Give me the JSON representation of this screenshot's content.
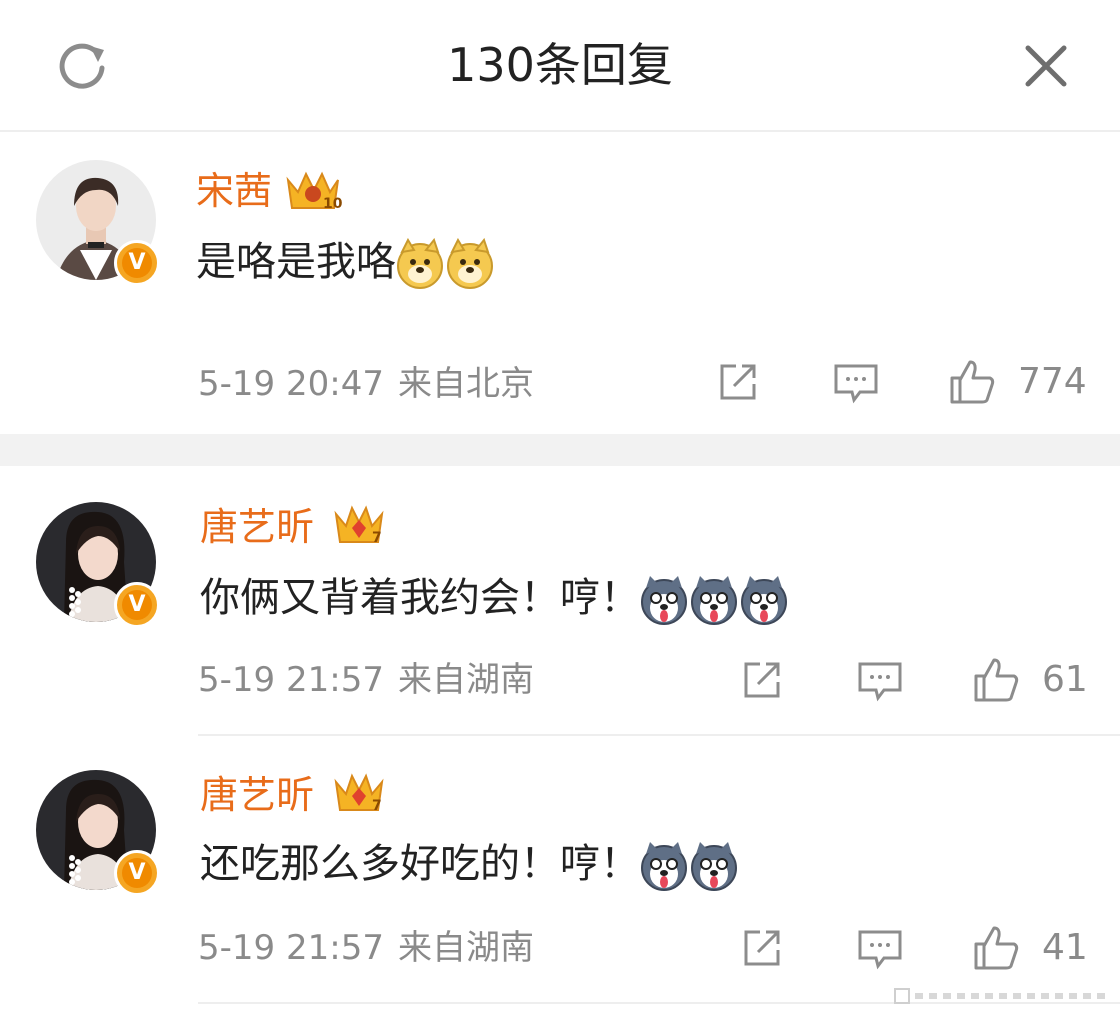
{
  "header": {
    "title": "130条回复"
  },
  "comments": [
    {
      "username": "宋茜",
      "level": "10",
      "text": "是咯是我咯",
      "emoji": [
        "doge-emoji",
        "doge-emoji"
      ],
      "date": "5-19 20:47",
      "location": "来自北京",
      "likes": "774"
    },
    {
      "username": "唐艺昕",
      "level": "7",
      "text": "你俩又背着我约会！哼！",
      "emoji": [
        "husky-emoji",
        "husky-emoji",
        "husky-emoji"
      ],
      "date": "5-19 21:57",
      "location": "来自湖南",
      "likes": "61"
    },
    {
      "username": "唐艺昕",
      "level": "7",
      "text": "还吃那么多好吃的！哼！",
      "emoji": [
        "husky-emoji",
        "husky-emoji"
      ],
      "date": "5-19 21:57",
      "location": "来自湖南",
      "likes": "41"
    }
  ],
  "verified_badge": "V",
  "colors": {
    "username": "#e86c1a",
    "meta": "#8a8a8a",
    "badge": "#f08a00"
  }
}
